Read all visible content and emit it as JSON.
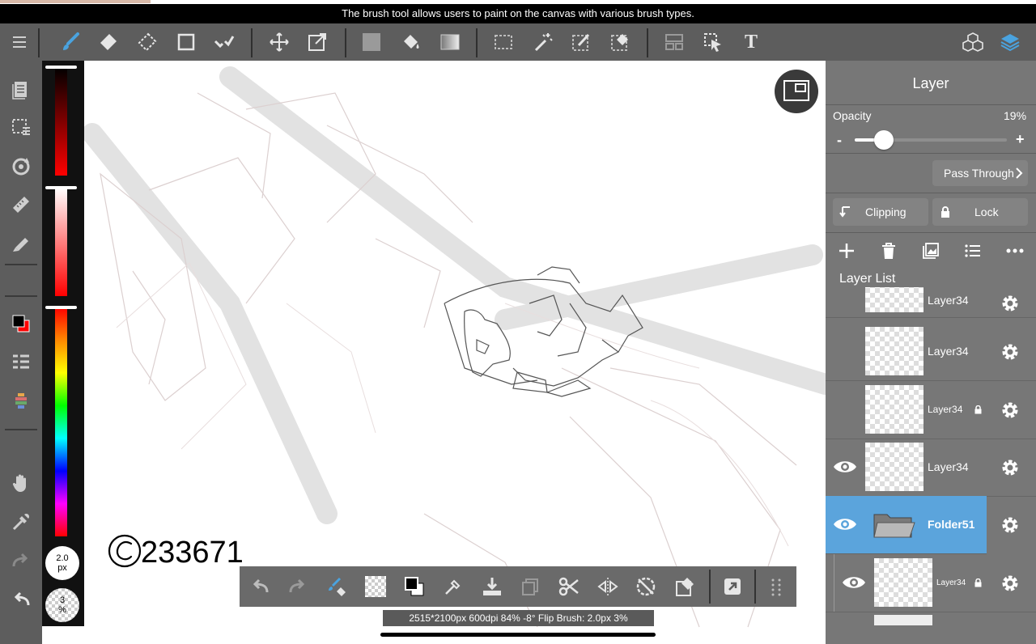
{
  "tooltip": "The brush tool allows users to paint on the canvas with various brush types.",
  "toolbar": {
    "menu_icon": "hamburger-icon",
    "tools": [
      "brush-icon",
      "eraser-icon",
      "blur-eraser-icon",
      "shape-icon",
      "select-check-icon",
      "move-icon",
      "transform-icon",
      "fill-color-icon",
      "bucket-icon",
      "gradient-icon",
      "rect-select-icon",
      "magic-wand-icon",
      "select-pen-icon",
      "select-eraser-icon",
      "layout-icon",
      "select-arrow-icon",
      "text-icon",
      "materials-icon",
      "layers-icon"
    ],
    "text_tool_label": "T"
  },
  "left_tools": [
    "layer-pages-icon",
    "selection-icon",
    "rotate-icon",
    "ruler-icon",
    "fill-pen-icon",
    "color-swatch-icon",
    "list-icon",
    "palette-icon",
    "hand-icon",
    "eyedropper-icon",
    "redo-icon",
    "undo-icon"
  ],
  "color_panel": {
    "brush_size": "2.0",
    "brush_size_unit": "px",
    "opacity": "3",
    "opacity_unit": "%",
    "primary_color": "#000000",
    "secondary_color": "#ff0000"
  },
  "canvas": {
    "signature_text": "©233671"
  },
  "bottom_bar": {
    "tools": [
      "undo-icon",
      "redo-icon",
      "brush-eraser-toggle-icon",
      "transparent-color-icon",
      "color-swap-icon",
      "eyedropper-icon",
      "save-icon",
      "copy-icon",
      "cut-icon",
      "flip-icon",
      "no-rotate-icon",
      "clear-icon",
      "export-icon",
      "grid-menu-icon"
    ]
  },
  "status_bar": "2515*2100px 600dpi 84% -8° Flip Brush: 2.0px 3%",
  "layer_panel": {
    "title": "Layer",
    "opacity_label": "Opacity",
    "opacity_value": "19%",
    "opacity_fraction": 0.19,
    "minus": "-",
    "plus": "+",
    "blend_mode": "Pass Through",
    "clipping_label": "Clipping",
    "lock_label": "Lock",
    "list_label": "Layer List",
    "layers": [
      {
        "name": "Layer34",
        "visible": false,
        "locked": false,
        "selected": false
      },
      {
        "name": "Layer34",
        "visible": false,
        "locked": false,
        "selected": false
      },
      {
        "name": "Layer34",
        "visible": false,
        "locked": true,
        "selected": false
      },
      {
        "name": "Layer34",
        "visible": true,
        "locked": false,
        "selected": false
      },
      {
        "name": "Folder51",
        "visible": true,
        "locked": false,
        "selected": true,
        "folder": true
      },
      {
        "name": "Layer34",
        "visible": true,
        "locked": true,
        "selected": false,
        "child": true
      }
    ]
  },
  "colors": {
    "toolbar_bg": "#5d5d5d",
    "accent": "#4aa3df",
    "selected_layer": "#5ba4dc",
    "panel_bg": "#777777"
  }
}
